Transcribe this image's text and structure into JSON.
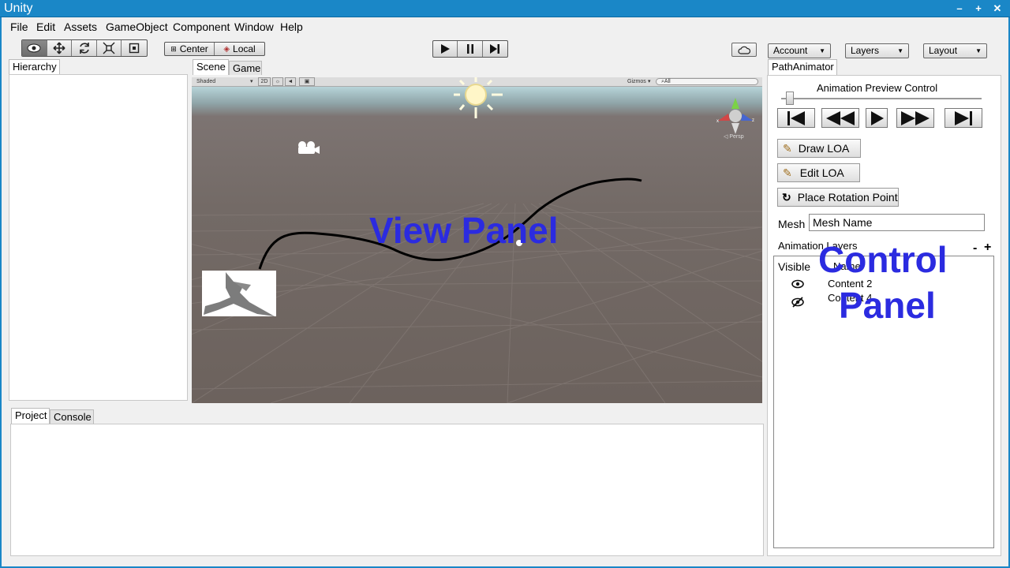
{
  "window": {
    "title": "Unity",
    "controls": [
      "–",
      "+",
      "✕"
    ]
  },
  "menu": [
    "File",
    "Edit",
    "Assets",
    "GameObject",
    "Component",
    "Window",
    "Help"
  ],
  "toolbar": {
    "pivot_label": "Center",
    "space_label": "Local",
    "account_label": "Account",
    "layers_label": "Layers",
    "layout_label": "Layout"
  },
  "hierarchy": {
    "tab": "Hierarchy"
  },
  "scene": {
    "tabs": [
      "Scene",
      "Game"
    ],
    "shading_mode": "Shaded",
    "mode_2d": "2D",
    "gizmos_label": "Gizmos",
    "search_placeholder": "All",
    "persp_label": "Persp",
    "overlay_text": "View Panel"
  },
  "bottom": {
    "tabs": [
      "Project",
      "Console"
    ]
  },
  "control": {
    "tab": "PathAnimator",
    "preview_title": "Animation Preview Control",
    "draw_loa": "Draw LOA",
    "edit_loa": "Edit LOA",
    "place_rotation": "Place Rotation Point",
    "mesh_label": "Mesh",
    "mesh_value": "Mesh Name",
    "layers_title": "Animation Layers",
    "remove_label": "-",
    "add_label": "+",
    "col_visible": "Visible",
    "col_name": "Name",
    "rows": [
      {
        "name": "Content 2",
        "visible": true
      },
      {
        "name": "Content 4",
        "visible": false
      }
    ],
    "overlay_line1": "Control",
    "overlay_line2": "Panel"
  },
  "colors": {
    "frame": "#1a87c7",
    "overlay": "#2b2be0"
  }
}
